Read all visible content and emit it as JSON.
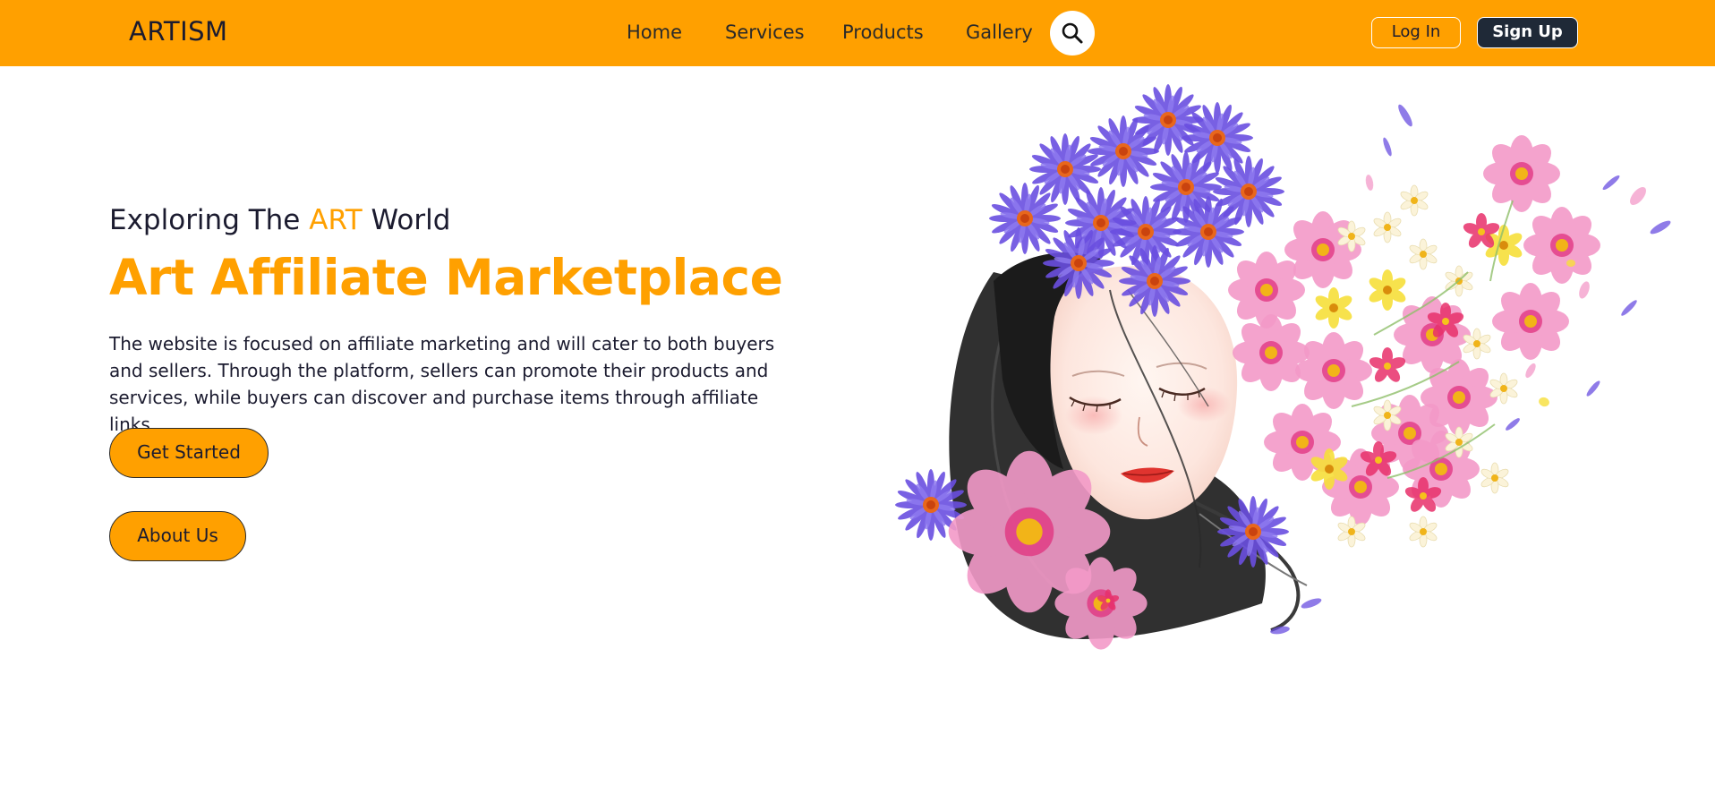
{
  "header": {
    "brand": "ARTISM",
    "nav": {
      "home": "Home",
      "services": "Services",
      "products": "Products",
      "gallery": "Gallery"
    },
    "search_icon": "search-icon",
    "login_label": "Log In",
    "signup_label": "Sign Up"
  },
  "hero": {
    "eyebrow_prefix": "Exploring The",
    "eyebrow_accent": "ART",
    "eyebrow_suffix": "World",
    "title": "Art Affiliate Marketplace",
    "description": "The website is focused on affiliate marketing and will cater to both buyers and sellers. Through the platform, sellers can promote their products and services, while buyers can discover and purchase items through affiliate links.",
    "get_started_label": "Get Started",
    "about_label": "About Us"
  },
  "colors": {
    "accent": "#ffa000",
    "dark": "#1f2937",
    "text": "#1b1b2f",
    "background": "#ffffff"
  }
}
